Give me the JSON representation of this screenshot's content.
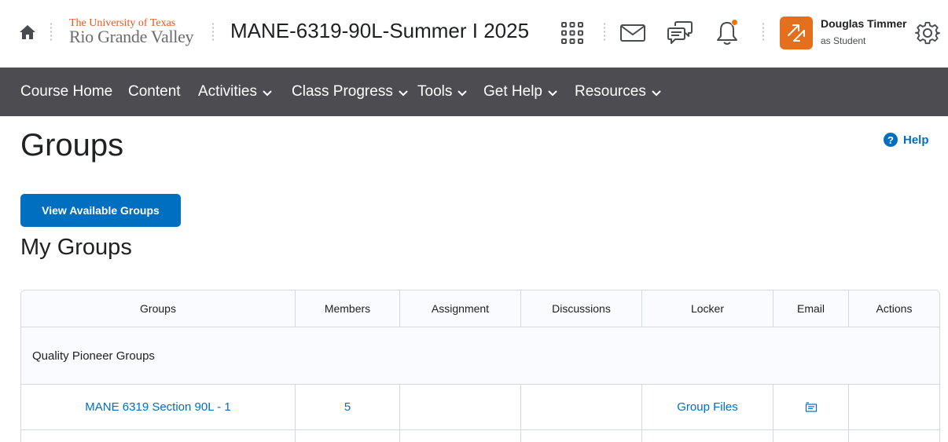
{
  "header": {
    "logo_top": "The University of Texas",
    "logo_bottom": "Rio Grande Valley",
    "course_title": "MANE-6319-90L-Summer I 2025",
    "icons": [
      "home-icon",
      "waffle-grid-icon",
      "mail-icon",
      "chat-icon",
      "bell-icon",
      "settings-gear-icon"
    ],
    "user": {
      "name": "Douglas Timmer",
      "role": "as Student"
    },
    "colors": {
      "accent": "#e4701d",
      "notification": "#e87511"
    }
  },
  "nav": {
    "items": [
      {
        "label": "Course Home",
        "dropdown": false
      },
      {
        "label": "Content",
        "dropdown": false
      },
      {
        "label": "Activities",
        "dropdown": true
      },
      {
        "label": "Class Progress",
        "dropdown": true
      },
      {
        "label": "Tools",
        "dropdown": true
      },
      {
        "label": "Get Help",
        "dropdown": true
      },
      {
        "label": "Resources",
        "dropdown": true
      }
    ],
    "background": "#4d4c50"
  },
  "page": {
    "title": "Groups",
    "help_label": "Help",
    "help_symbol": "?",
    "view_groups_button": "View Available Groups",
    "section_title": "My Groups"
  },
  "table": {
    "columns": [
      "Groups",
      "Members",
      "Assignment",
      "Discussions",
      "Locker",
      "Email",
      "Actions"
    ],
    "category": "Quality Pioneer Groups",
    "rows": [
      {
        "group": "MANE 6319 Section 90L - 1",
        "members": "5",
        "assignment": "",
        "discussions": "",
        "locker": "Group Files",
        "email": "email-icon",
        "actions": ""
      }
    ]
  },
  "colors": {
    "link": "#006fbf",
    "primary_button": "#006fbf",
    "text": "#202122"
  }
}
